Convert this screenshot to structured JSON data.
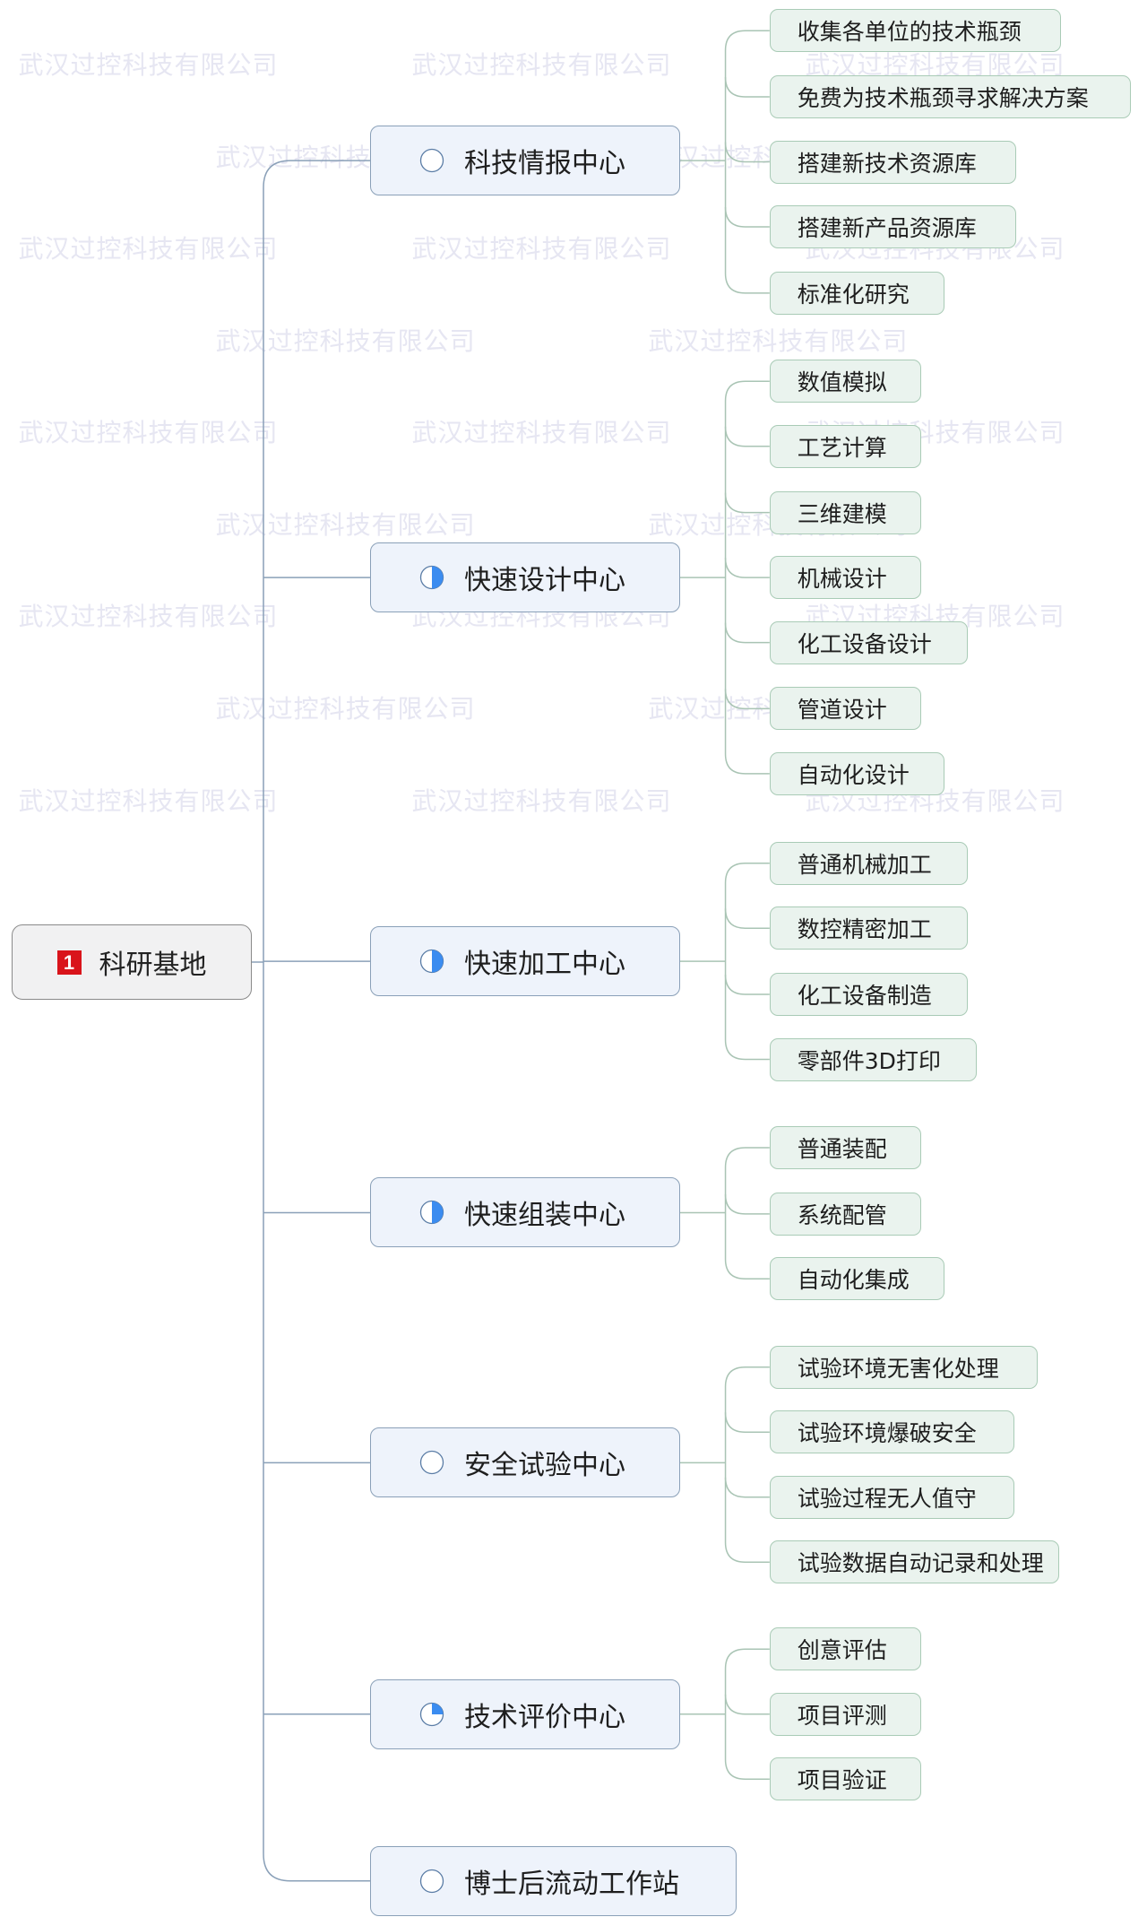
{
  "watermark": "武汉过控科技有限公司",
  "colors": {
    "root_badge": "#d9141b",
    "progress_fill": "#3b8cf0",
    "l1_border": "#8aa0b8",
    "l2_border": "#a9cbb6",
    "l1_link": "#8aa0b8",
    "l2_link": "#a9c4b4"
  },
  "root": {
    "marker": "1",
    "label": "科研基地"
  },
  "branches": [
    {
      "label": "科技情报中心",
      "progress": 0,
      "children": [
        "收集各单位的技术瓶颈",
        "免费为技术瓶颈寻求解决方案",
        "搭建新技术资源库",
        "搭建新产品资源库",
        "标准化研究"
      ]
    },
    {
      "label": "快速设计中心",
      "progress": 0.5,
      "children": [
        "数值模拟",
        "工艺计算",
        "三维建模",
        "机械设计",
        "化工设备设计",
        "管道设计",
        "自动化设计"
      ]
    },
    {
      "label": "快速加工中心",
      "progress": 0.5,
      "children": [
        "普通机械加工",
        "数控精密加工",
        "化工设备制造",
        "零部件3D打印"
      ]
    },
    {
      "label": "快速组装中心",
      "progress": 0.5,
      "children": [
        "普通装配",
        "系统配管",
        "自动化集成"
      ]
    },
    {
      "label": "安全试验中心",
      "progress": 0,
      "children": [
        "试验环境无害化处理",
        "试验环境爆破安全",
        "试验过程无人值守",
        "试验数据自动记录和处理"
      ]
    },
    {
      "label": "技术评价中心",
      "progress": 0.25,
      "children": [
        "创意评估",
        "项目评测",
        "项目验证"
      ]
    },
    {
      "label": "博士后流动工作站",
      "progress": 0,
      "children": []
    }
  ]
}
